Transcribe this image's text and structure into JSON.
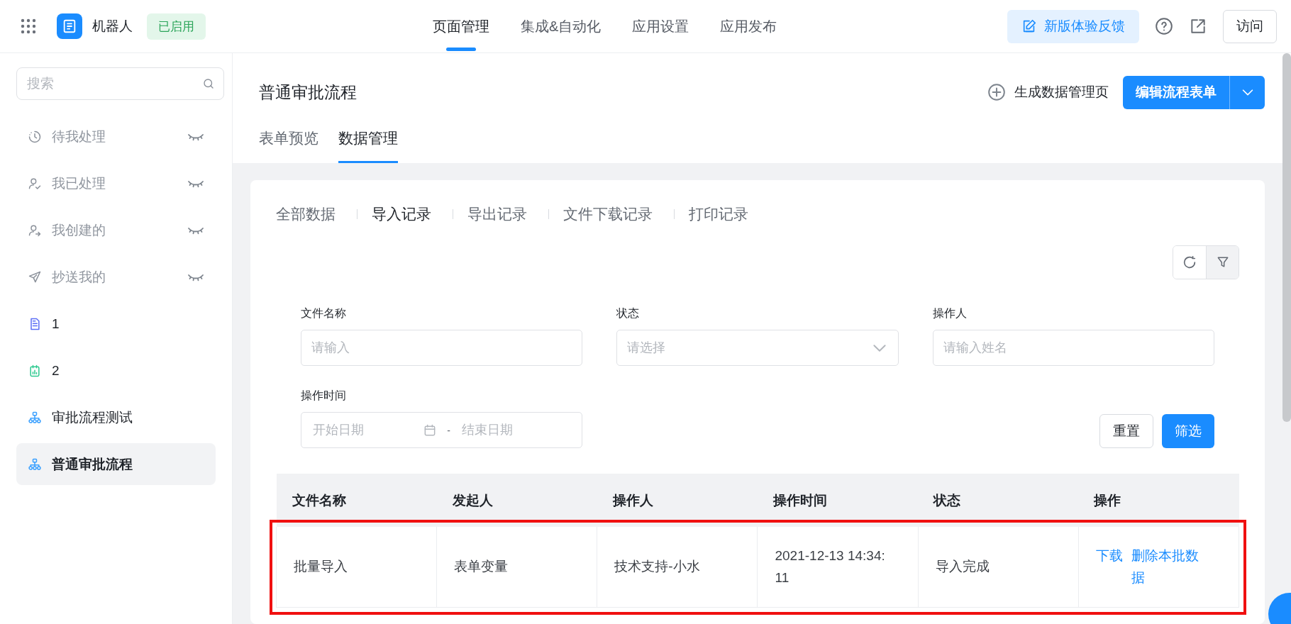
{
  "topbar": {
    "app_name": "机器人",
    "status_badge": "已启用",
    "nav": [
      {
        "label": "页面管理",
        "selected": true
      },
      {
        "label": "集成&自动化",
        "selected": false
      },
      {
        "label": "应用设置",
        "selected": false
      },
      {
        "label": "应用发布",
        "selected": false
      }
    ],
    "feedback_button": "新版体验反馈",
    "visit_button": "访问"
  },
  "sidebar": {
    "search": {
      "placeholder": "搜索"
    },
    "items": [
      {
        "label": "待我处理",
        "kind": "pending",
        "hidden": true,
        "selected": false
      },
      {
        "label": "我已处理",
        "kind": "handled",
        "hidden": true,
        "selected": false
      },
      {
        "label": "我创建的",
        "kind": "created",
        "hidden": true,
        "selected": false
      },
      {
        "label": "抄送我的",
        "kind": "cc",
        "hidden": true,
        "selected": false
      },
      {
        "label": "1",
        "kind": "form",
        "hidden": false,
        "selected": false
      },
      {
        "label": "2",
        "kind": "report",
        "hidden": false,
        "selected": false
      },
      {
        "label": "审批流程测试",
        "kind": "flow",
        "hidden": false,
        "selected": false
      },
      {
        "label": "普通审批流程",
        "kind": "flow",
        "hidden": false,
        "selected": true
      }
    ]
  },
  "main": {
    "title": "普通审批流程",
    "generate_link": "生成数据管理页",
    "edit_button": "编辑流程表单",
    "tabs": [
      {
        "label": "表单预览",
        "selected": false
      },
      {
        "label": "数据管理",
        "selected": true
      }
    ],
    "subtabs": [
      {
        "label": "全部数据",
        "selected": false
      },
      {
        "label": "导入记录",
        "selected": true
      },
      {
        "label": "导出记录",
        "selected": false
      },
      {
        "label": "文件下载记录",
        "selected": false
      },
      {
        "label": "打印记录",
        "selected": false
      }
    ],
    "filters": [
      {
        "label": "文件名称",
        "kind": "text",
        "placeholder": "请输入"
      },
      {
        "label": "状态",
        "kind": "select",
        "placeholder": "请选择"
      },
      {
        "label": "操作人",
        "kind": "text",
        "placeholder": "请输入姓名"
      },
      {
        "label": "操作时间",
        "kind": "daterange",
        "start_placeholder": "开始日期",
        "separator": "-",
        "end_placeholder": "结束日期"
      }
    ],
    "reset_button": "重置",
    "filter_button": "筛选",
    "table": {
      "columns": [
        "文件名称",
        "发起人",
        "操作人",
        "操作时间",
        "状态",
        "操作"
      ],
      "rows": [
        {
          "cells": [
            "批量导入",
            "表单变量",
            "技术支持-小水",
            "2021-12-13 14:34:11",
            "导入完成"
          ],
          "actions": [
            "下载",
            "删除本批数据"
          ],
          "highlighted": true
        }
      ]
    }
  }
}
